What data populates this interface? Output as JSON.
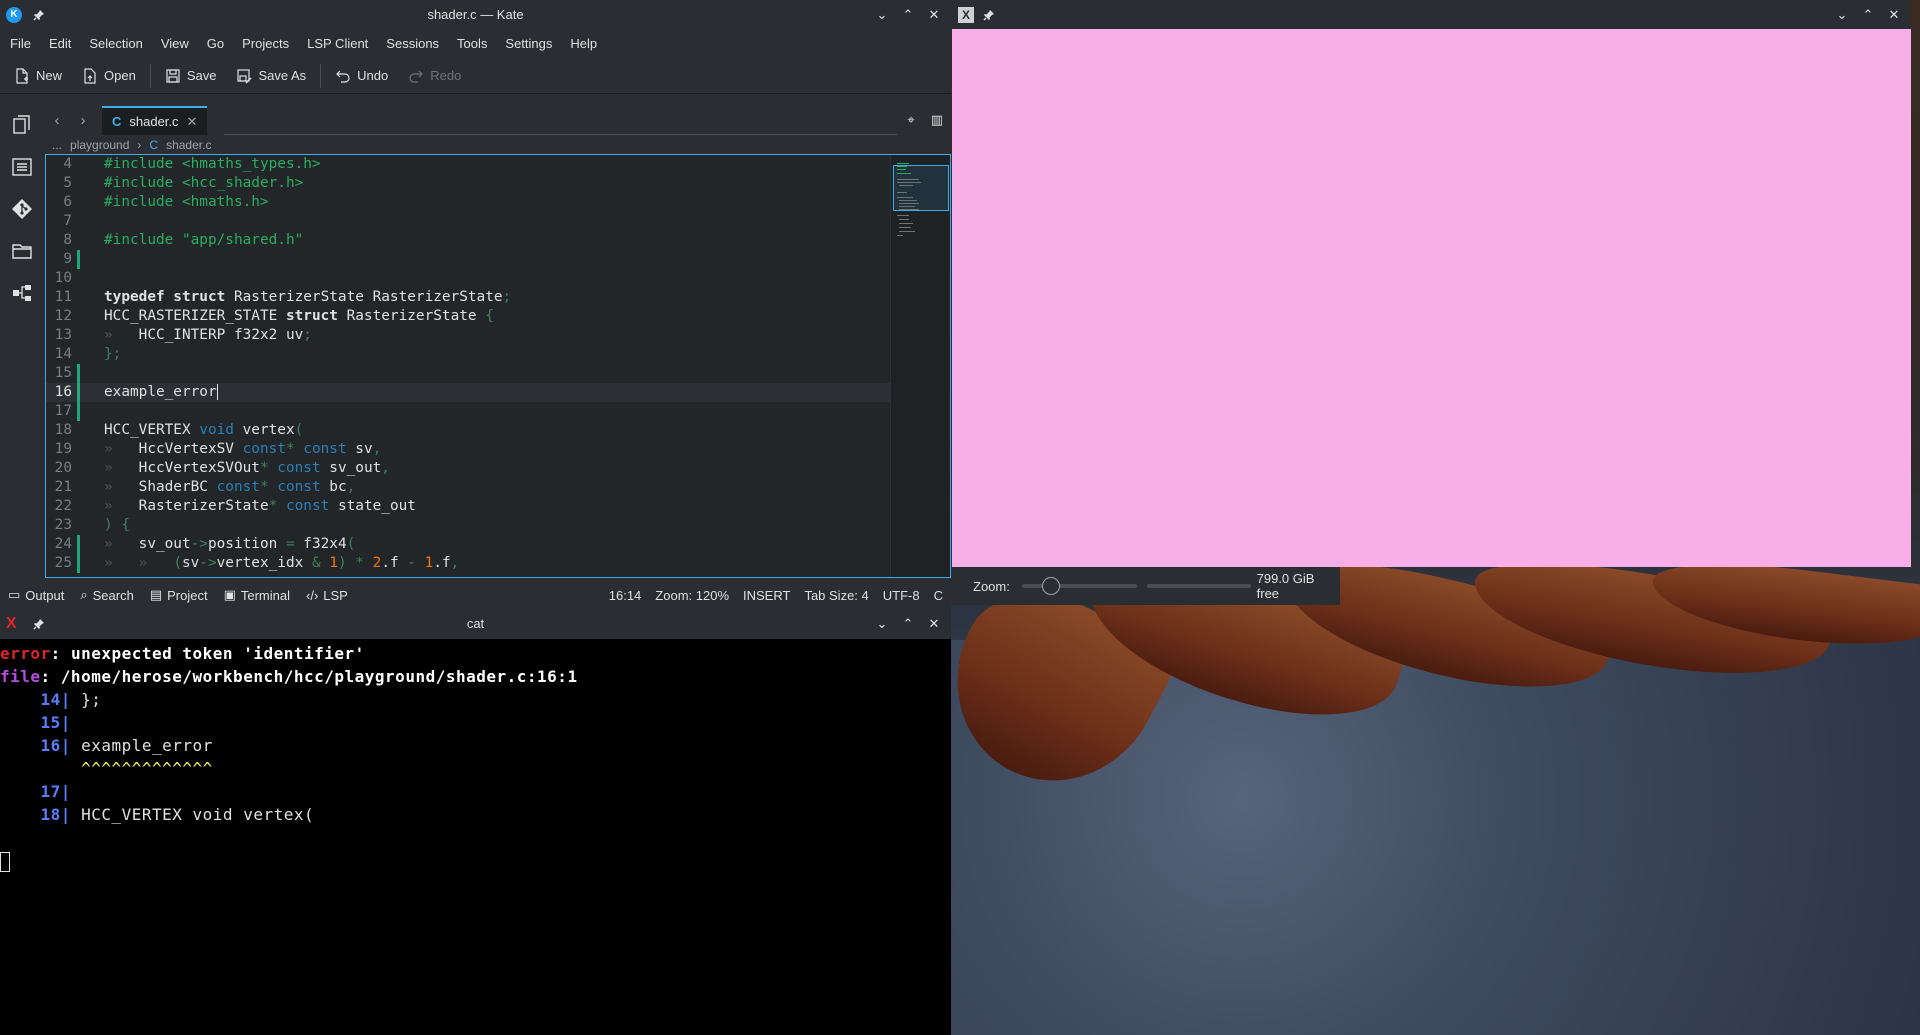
{
  "kate": {
    "title": "shader.c — Kate",
    "menu": [
      "File",
      "Edit",
      "Selection",
      "View",
      "Go",
      "Projects",
      "LSP Client",
      "Sessions",
      "Tools",
      "Settings",
      "Help"
    ],
    "toolbar": {
      "new": "New",
      "open": "Open",
      "save": "Save",
      "save_as": "Save As",
      "undo": "Undo",
      "redo": "Redo"
    },
    "tab": {
      "label": "shader.c"
    },
    "breadcrumb": {
      "root": "...",
      "folder": "playground",
      "file": "shader.c"
    },
    "line_numbers": [
      "4",
      "5",
      "6",
      "7",
      "8",
      "9",
      "10",
      "11",
      "12",
      "13",
      "14",
      "15",
      "16",
      "17",
      "18",
      "19",
      "20",
      "21",
      "22",
      "23",
      "24",
      "25"
    ],
    "status": {
      "output": "Output",
      "search": "Search",
      "project": "Project",
      "terminal": "Terminal",
      "lsp": "LSP",
      "position": "16:14",
      "zoom": "Zoom: 120%",
      "mode": "INSERT",
      "tab_size": "Tab Size: 4",
      "encoding": "UTF-8",
      "lang": "C"
    }
  },
  "terminal": {
    "title": "cat",
    "error_label": "error",
    "error_msg": ": unexpected token 'identifier'",
    "file_label": "file",
    "file_path": ": /home/herose/workbench/hcc/playground/shader.c:16:1",
    "lines": [
      {
        "num": "14",
        "text": "};"
      },
      {
        "num": "15",
        "text": ""
      },
      {
        "num": "16",
        "text": "example_error"
      },
      {
        "num": "17",
        "text": ""
      },
      {
        "num": "18",
        "text": "HCC_VERTEX void vertex("
      }
    ],
    "carets": "^^^^^^^^^^^^^"
  },
  "viewer": {
    "zoom_label": "Zoom:",
    "free_space": "799.0 GiB free"
  },
  "colors": {
    "accent": "#3daee9",
    "window_bg": "#2a2e32",
    "editor_bg": "#232629",
    "preview_pink": "#f8aee6",
    "error_red": "#e0242c"
  }
}
